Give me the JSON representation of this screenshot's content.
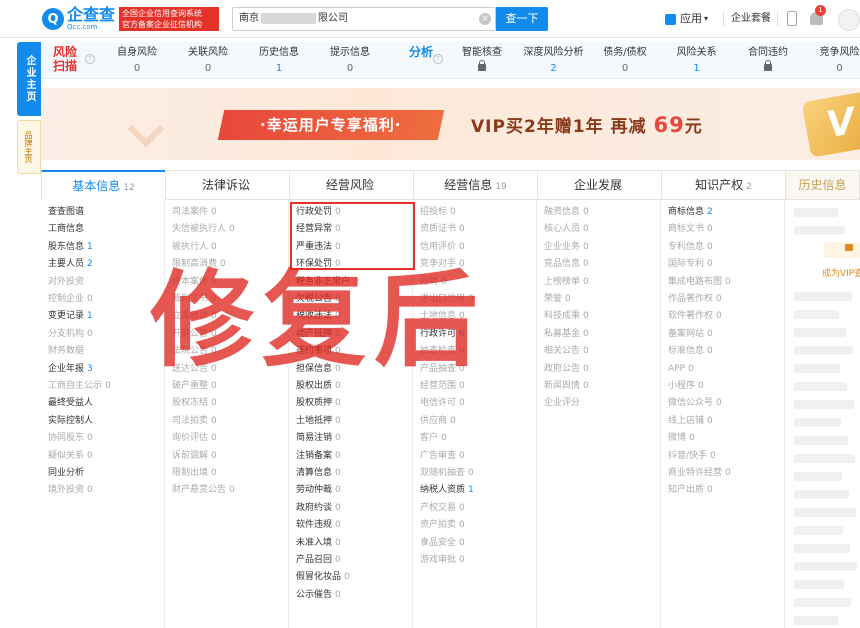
{
  "header": {
    "logo_cn": "企查查",
    "logo_en": "Qcc.com",
    "logo_badge": [
      "全国企业信用查询系统",
      "官方备案企业征信机构"
    ],
    "search_prefix": "南京",
    "search_suffix": "限公司",
    "search_button": "查一下",
    "app_menu": "应用",
    "suite": "企业套餐",
    "notification_count": "1"
  },
  "side_tabs": {
    "main": "企业主页",
    "brand": "品牌主页"
  },
  "risk_bar": {
    "risk_title": "风险扫描",
    "risk_items": [
      {
        "label": "自身风险",
        "value": "0",
        "locked": false
      },
      {
        "label": "关联风险",
        "value": "0",
        "locked": false
      },
      {
        "label": "历史信息",
        "value": "1",
        "locked": false
      },
      {
        "label": "提示信息",
        "value": "0",
        "locked": false
      }
    ],
    "analysis_title": "分析",
    "analysis_items": [
      {
        "label": "智能核查",
        "value": "",
        "locked": true
      },
      {
        "label": "深度风险分析",
        "value": "2",
        "locked": false
      },
      {
        "label": "债务/债权",
        "value": "0",
        "locked": false
      },
      {
        "label": "风险关系",
        "value": "1",
        "locked": false
      },
      {
        "label": "合同违约",
        "value": "",
        "locked": true
      },
      {
        "label": "竞争风险",
        "value": "0",
        "locked": false
      }
    ]
  },
  "banner": {
    "button": "·幸运用户专享福利·",
    "offer": "VIP买2年赠1年  再减",
    "price": "69",
    "unit": "元",
    "badge": "V"
  },
  "tabs": [
    {
      "label": "基本信息",
      "count": "12"
    },
    {
      "label": "法律诉讼",
      "count": ""
    },
    {
      "label": "经营风险",
      "count": ""
    },
    {
      "label": "经营信息",
      "count": "19"
    },
    {
      "label": "企业发展",
      "count": ""
    },
    {
      "label": "知识产权",
      "count": "2"
    },
    {
      "label": "历史信息",
      "count": ""
    }
  ],
  "columns": {
    "basic": [
      {
        "t": "查查图谱",
        "n": "",
        "s": "dark"
      },
      {
        "t": "工商信息",
        "n": "",
        "s": "dark"
      },
      {
        "t": "股东信息",
        "n": "1",
        "s": "dark"
      },
      {
        "t": "主要人员",
        "n": "2",
        "s": "dark"
      },
      {
        "t": "对外投资",
        "n": "",
        "s": "dim"
      },
      {
        "t": "控制企业",
        "n": "0",
        "s": "dim"
      },
      {
        "t": "变更记录",
        "n": "1",
        "s": "dark"
      },
      {
        "t": "分支机构",
        "n": "0",
        "s": "dim"
      },
      {
        "t": "财务数据",
        "n": "",
        "s": "dim"
      },
      {
        "t": "企业年报",
        "n": "3",
        "s": "dark"
      },
      {
        "t": "工商自主公示",
        "n": "0",
        "s": "dim"
      },
      {
        "t": "最终受益人",
        "n": "",
        "s": "dark"
      },
      {
        "t": "实际控制人",
        "n": "",
        "s": "dark"
      },
      {
        "t": "协同股东",
        "n": "0",
        "s": "dim"
      },
      {
        "t": "疑似关系",
        "n": "0",
        "s": "dim"
      },
      {
        "t": "同业分析",
        "n": "",
        "s": "dark"
      },
      {
        "t": "境外投资",
        "n": "0",
        "s": "dim"
      }
    ],
    "legal": [
      {
        "t": "司法案件",
        "n": "0"
      },
      {
        "t": "失信被执行人",
        "n": "0"
      },
      {
        "t": "被执行人",
        "n": "0"
      },
      {
        "t": "限制高消费",
        "n": "0"
      },
      {
        "t": "终本案件",
        "n": "0"
      },
      {
        "t": "裁判文书",
        "n": "0"
      },
      {
        "t": "立案信息",
        "n": "0"
      },
      {
        "t": "开庭公告",
        "n": "0"
      },
      {
        "t": "法院公告",
        "n": "0"
      },
      {
        "t": "送达公告",
        "n": "0"
      },
      {
        "t": "破产重整",
        "n": "0"
      },
      {
        "t": "股权冻结",
        "n": "0"
      },
      {
        "t": "司法拍卖",
        "n": "0"
      },
      {
        "t": "询价评估",
        "n": "0"
      },
      {
        "t": "诉前调解",
        "n": "0"
      },
      {
        "t": "限制出境",
        "n": "0"
      },
      {
        "t": "财产悬赏公告",
        "n": "0"
      }
    ],
    "risk": [
      {
        "t": "行政处罚",
        "n": "0"
      },
      {
        "t": "经营异常",
        "n": "0"
      },
      {
        "t": "严重违法",
        "n": "0"
      },
      {
        "t": "环保处罚",
        "n": "0"
      },
      {
        "t": "税务非正常户",
        "n": "0"
      },
      {
        "t": "欠税公告",
        "n": "0"
      },
      {
        "t": "税收违法",
        "n": "0"
      },
      {
        "t": "动产抵押",
        "n": "0"
      },
      {
        "t": "违约事项",
        "n": "0"
      },
      {
        "t": "担保信息",
        "n": "0"
      },
      {
        "t": "股权出质",
        "n": "0"
      },
      {
        "t": "股权质押",
        "n": "0"
      },
      {
        "t": "土地抵押",
        "n": "0"
      },
      {
        "t": "简易注销",
        "n": "0"
      },
      {
        "t": "注销备案",
        "n": "0"
      },
      {
        "t": "清算信息",
        "n": "0"
      },
      {
        "t": "劳动仲裁",
        "n": "0"
      },
      {
        "t": "政府约谈",
        "n": "0"
      },
      {
        "t": "软件违规",
        "n": "0"
      },
      {
        "t": "未准入境",
        "n": "0"
      },
      {
        "t": "产品召回",
        "n": "0"
      },
      {
        "t": "假冒化妆品",
        "n": "0"
      },
      {
        "t": "公示催告",
        "n": "0"
      }
    ],
    "biz": [
      {
        "t": "招投标",
        "n": "0",
        "s": "dim"
      },
      {
        "t": "资质证书",
        "n": "0",
        "s": "dim"
      },
      {
        "t": "信用评价",
        "n": "0",
        "s": "dim"
      },
      {
        "t": "竞争对手",
        "n": "0",
        "s": "dim"
      },
      {
        "t": "招聘",
        "n": "0",
        "s": "dim"
      },
      {
        "t": "进出口信用",
        "n": "0",
        "s": "dim"
      },
      {
        "t": "土地信息",
        "n": "0",
        "s": "dim"
      },
      {
        "t": "行政许可",
        "n": "6",
        "s": "dark"
      },
      {
        "t": "抽查检查",
        "n": "0",
        "s": "dim"
      },
      {
        "t": "产品抽查",
        "n": "0",
        "s": "dim"
      },
      {
        "t": "经营范围",
        "n": "0",
        "s": "dim"
      },
      {
        "t": "电信许可",
        "n": "0",
        "s": "dim"
      },
      {
        "t": "供应商",
        "n": "0",
        "s": "dim"
      },
      {
        "t": "客户",
        "n": "0",
        "s": "dim"
      },
      {
        "t": "广告审查",
        "n": "0",
        "s": "dim"
      },
      {
        "t": "双随机抽查",
        "n": "0",
        "s": "dim"
      },
      {
        "t": "纳税人资质",
        "n": "1",
        "s": "dark"
      },
      {
        "t": "产权交易",
        "n": "0",
        "s": "dim"
      },
      {
        "t": "资产拍卖",
        "n": "0",
        "s": "dim"
      },
      {
        "t": "食品安全",
        "n": "0",
        "s": "dim"
      },
      {
        "t": "游戏审批",
        "n": "0",
        "s": "dim"
      }
    ],
    "dev": [
      {
        "t": "融资信息",
        "n": "0"
      },
      {
        "t": "核心人员",
        "n": "0"
      },
      {
        "t": "企业业务",
        "n": "0"
      },
      {
        "t": "竞品信息",
        "n": "0"
      },
      {
        "t": "上榜榜单",
        "n": "0"
      },
      {
        "t": "荣誉",
        "n": "0"
      },
      {
        "t": "科技成果",
        "n": "0"
      },
      {
        "t": "私募基金",
        "n": "0"
      },
      {
        "t": "相关公告",
        "n": "0"
      },
      {
        "t": "政府公告",
        "n": "0"
      },
      {
        "t": "新闻舆情",
        "n": "0"
      },
      {
        "t": "企业评分",
        "n": ""
      }
    ],
    "ip": [
      {
        "t": "商标信息",
        "n": "2",
        "s": "dark"
      },
      {
        "t": "商标文书",
        "n": "0",
        "s": "dim"
      },
      {
        "t": "专利信息",
        "n": "0",
        "s": "dim"
      },
      {
        "t": "国际专利",
        "n": "0",
        "s": "dim"
      },
      {
        "t": "集成电路布图",
        "n": "0",
        "s": "dim"
      },
      {
        "t": "作品著作权",
        "n": "0",
        "s": "dim"
      },
      {
        "t": "软件著作权",
        "n": "0",
        "s": "dim"
      },
      {
        "t": "备案网站",
        "n": "0",
        "s": "dim"
      },
      {
        "t": "标准信息",
        "n": "0",
        "s": "dim"
      },
      {
        "t": "APP",
        "n": "0",
        "s": "dim"
      },
      {
        "t": "小程序",
        "n": "0",
        "s": "dim"
      },
      {
        "t": "微信公众号",
        "n": "0",
        "s": "dim"
      },
      {
        "t": "线上店铺",
        "n": "0",
        "s": "dim"
      },
      {
        "t": "微博",
        "n": "0",
        "s": "dim"
      },
      {
        "t": "抖音/快手",
        "n": "0",
        "s": "dim"
      },
      {
        "t": "商业特许经营",
        "n": "0",
        "s": "dim"
      },
      {
        "t": "知产出质",
        "n": "0",
        "s": "dim"
      }
    ]
  },
  "history_vip": "成为VIP查",
  "watermark": "修复后",
  "colors": {
    "accent": "#128bed",
    "danger": "#e2322a",
    "vip": "#e08a1c"
  }
}
